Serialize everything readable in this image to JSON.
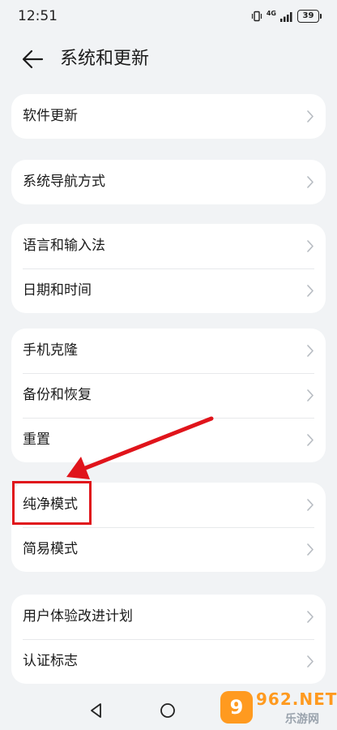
{
  "status_bar": {
    "time": "12:51",
    "network": "4G",
    "battery": "39",
    "icons": [
      "vibrate-icon",
      "signal-icon",
      "battery-icon"
    ]
  },
  "header": {
    "title": "系统和更新",
    "back_icon": "arrow-left-icon"
  },
  "cards": [
    {
      "items": [
        "软件更新"
      ]
    },
    {
      "items": [
        "系统导航方式"
      ]
    },
    {
      "items": [
        "语言和输入法",
        "日期和时间"
      ]
    },
    {
      "items": [
        "手机克隆",
        "备份和恢复",
        "重置"
      ]
    },
    {
      "items": [
        "纯净模式",
        "简易模式"
      ]
    },
    {
      "items": [
        "用户体验改进计划",
        "认证标志"
      ]
    }
  ],
  "annotation": {
    "highlighted_item": "纯净模式",
    "color": "#e0141b"
  },
  "nav_bar": {
    "icons": [
      "triangle-back-icon",
      "circle-home-icon"
    ]
  },
  "watermark": {
    "badge": "9",
    "domain": "962.NET",
    "name": "乐游网",
    "color": "#ff9a1f"
  },
  "colors": {
    "background": "#f1f3f5",
    "card": "#ffffff",
    "text": "#1b1b1b"
  }
}
